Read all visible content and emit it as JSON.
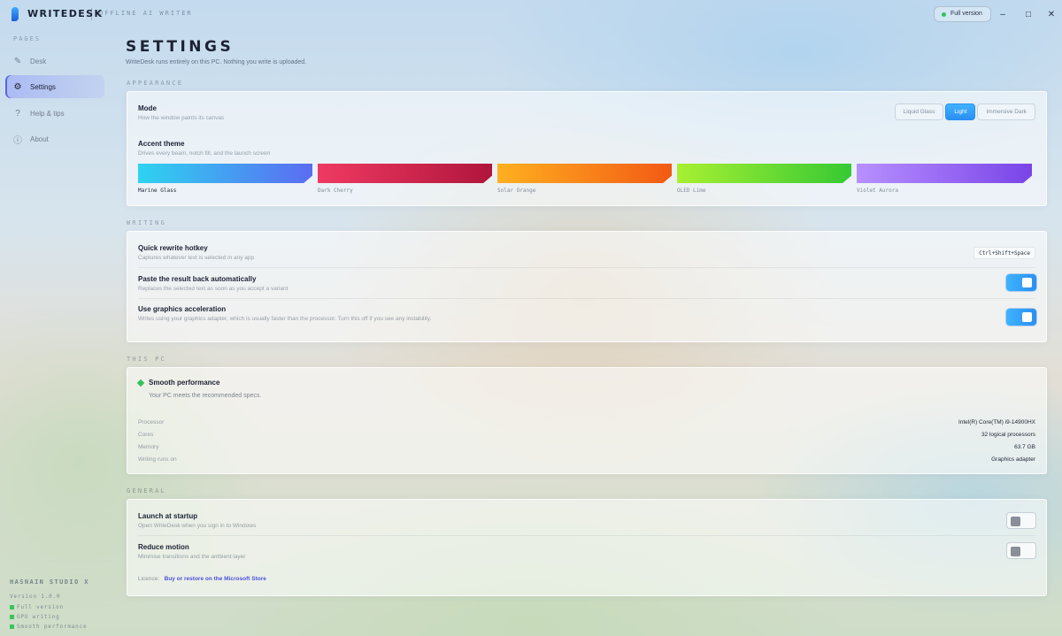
{
  "app": {
    "name": "WRITEDESK",
    "tagline": "OFFLINE AI WRITER",
    "full_version": "Full version",
    "window_controls": [
      "–",
      "□",
      "✕"
    ]
  },
  "sidebar": {
    "heading": "PAGES",
    "items": [
      {
        "label": "Desk",
        "icon": "pen-icon",
        "glyph": "✎",
        "active": false
      },
      {
        "label": "Settings",
        "icon": "gear-icon",
        "glyph": "⚙",
        "active": true
      },
      {
        "label": "Help & tips",
        "icon": "help-icon",
        "glyph": "?",
        "active": false
      },
      {
        "label": "About",
        "icon": "info-icon",
        "glyph": "ⓘ",
        "active": false
      }
    ],
    "studio": "HASNAIN STUDIO X",
    "meta": [
      "Version 1.0.0",
      "Full version",
      "GPU writing",
      "Smooth performance"
    ]
  },
  "page": {
    "title": "SETTINGS",
    "subtitle": "WriteDesk runs entirely on this PC. Nothing you write is uploaded."
  },
  "appearance": {
    "heading": "APPEARANCE",
    "mode_title": "Mode",
    "mode_desc": "How the window paints its canvas",
    "modes": [
      {
        "label": "Liquid Glass",
        "on": false
      },
      {
        "label": "Light",
        "on": true
      },
      {
        "label": "Immersive Dark",
        "on": false
      }
    ],
    "accent_title": "Accent theme",
    "accent_desc": "Drives every beam, notch fill, and the launch screen",
    "themes": [
      {
        "label": "Marine Glass",
        "from": "#2ed3f0",
        "to": "#5b6cf2"
      },
      {
        "label": "Dark Cherry",
        "from": "#ef3a62",
        "to": "#b0153c"
      },
      {
        "label": "Solar Orange",
        "from": "#ffb020",
        "to": "#f25a14"
      },
      {
        "label": "OLED Lime",
        "from": "#a8f032",
        "to": "#36c933"
      },
      {
        "label": "Violet Aurora",
        "from": "#b790ff",
        "to": "#7a44e8"
      }
    ]
  },
  "writing": {
    "heading": "WRITING",
    "hotkey_title": "Quick rewrite hotkey",
    "hotkey_desc": "Captures whatever text is selected in any app",
    "hotkey": "Ctrl+Shift+Space",
    "paste_title": "Paste the result back automatically",
    "paste_desc": "Replaces the selected text as soon as you accept a variant",
    "gpu_title": "Use graphics acceleration",
    "gpu_desc": "Writes using your graphics adapter, which is usually faster than the processor. Turn this off if you see any instability."
  },
  "this_pc": {
    "heading": "THIS PC",
    "status": "Smooth performance",
    "status_desc": "Your PC meets the recommended specs.",
    "specs": [
      {
        "key": "Processor",
        "value": "Intel(R) Core(TM) i9-14900HX"
      },
      {
        "key": "Cores",
        "value": "32 logical processors"
      },
      {
        "key": "Memory",
        "value": "63.7 GB"
      },
      {
        "key": "Writing runs on",
        "value": "Graphics adapter"
      }
    ]
  },
  "general": {
    "heading": "GENERAL",
    "startup_title": "Launch at startup",
    "startup_desc": "Open WriteDesk when you sign in to Windows",
    "motion_title": "Reduce motion",
    "motion_desc": "Minimise transitions and the ambient layer",
    "licence_label": "Licence:",
    "licence_link": "Buy or restore on the Microsoft Store"
  },
  "toggles": {
    "paste": true,
    "gpu": true,
    "startup": false,
    "motion": false
  },
  "colors": {
    "accent": "#2a8ff2",
    "nav_active": "#5a63f0",
    "status_green": "#36c15b",
    "link": "#4a52d8"
  }
}
